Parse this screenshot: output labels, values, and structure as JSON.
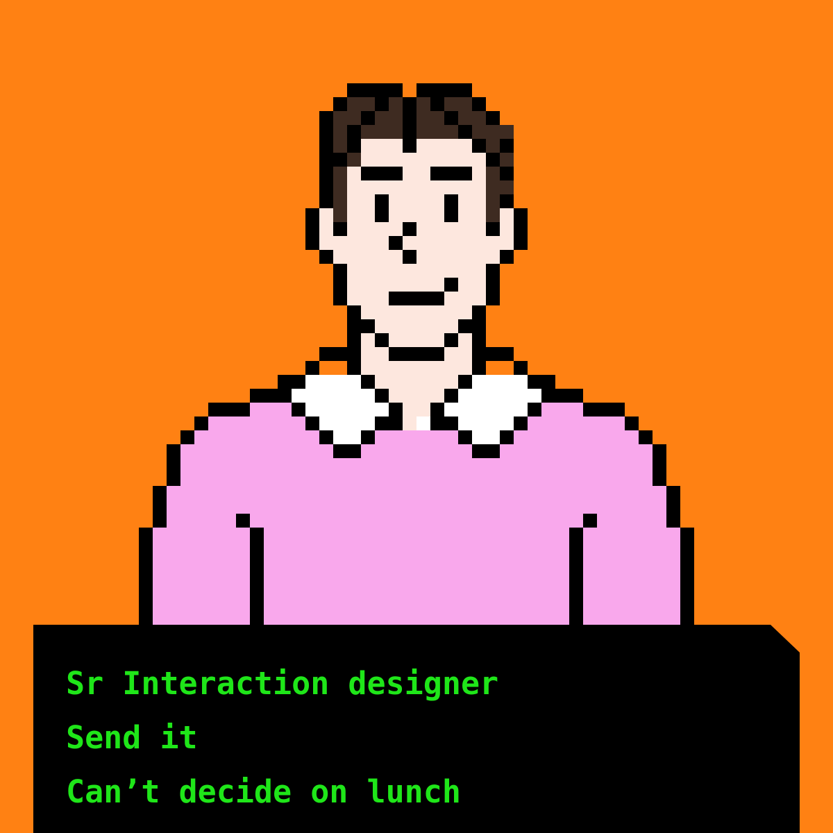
{
  "colors": {
    "background": "#ff8113",
    "outline": "#000000",
    "hair": "#3e2b21",
    "skin": "#fde7de",
    "shirt": "#f9a8ec",
    "collar": "#ffffff",
    "panel": "#000000",
    "text": "#1fe619"
  },
  "profile": {
    "lines": [
      "Sr Interaction designer",
      "Send it",
      "Can’t decide on lunch"
    ]
  }
}
